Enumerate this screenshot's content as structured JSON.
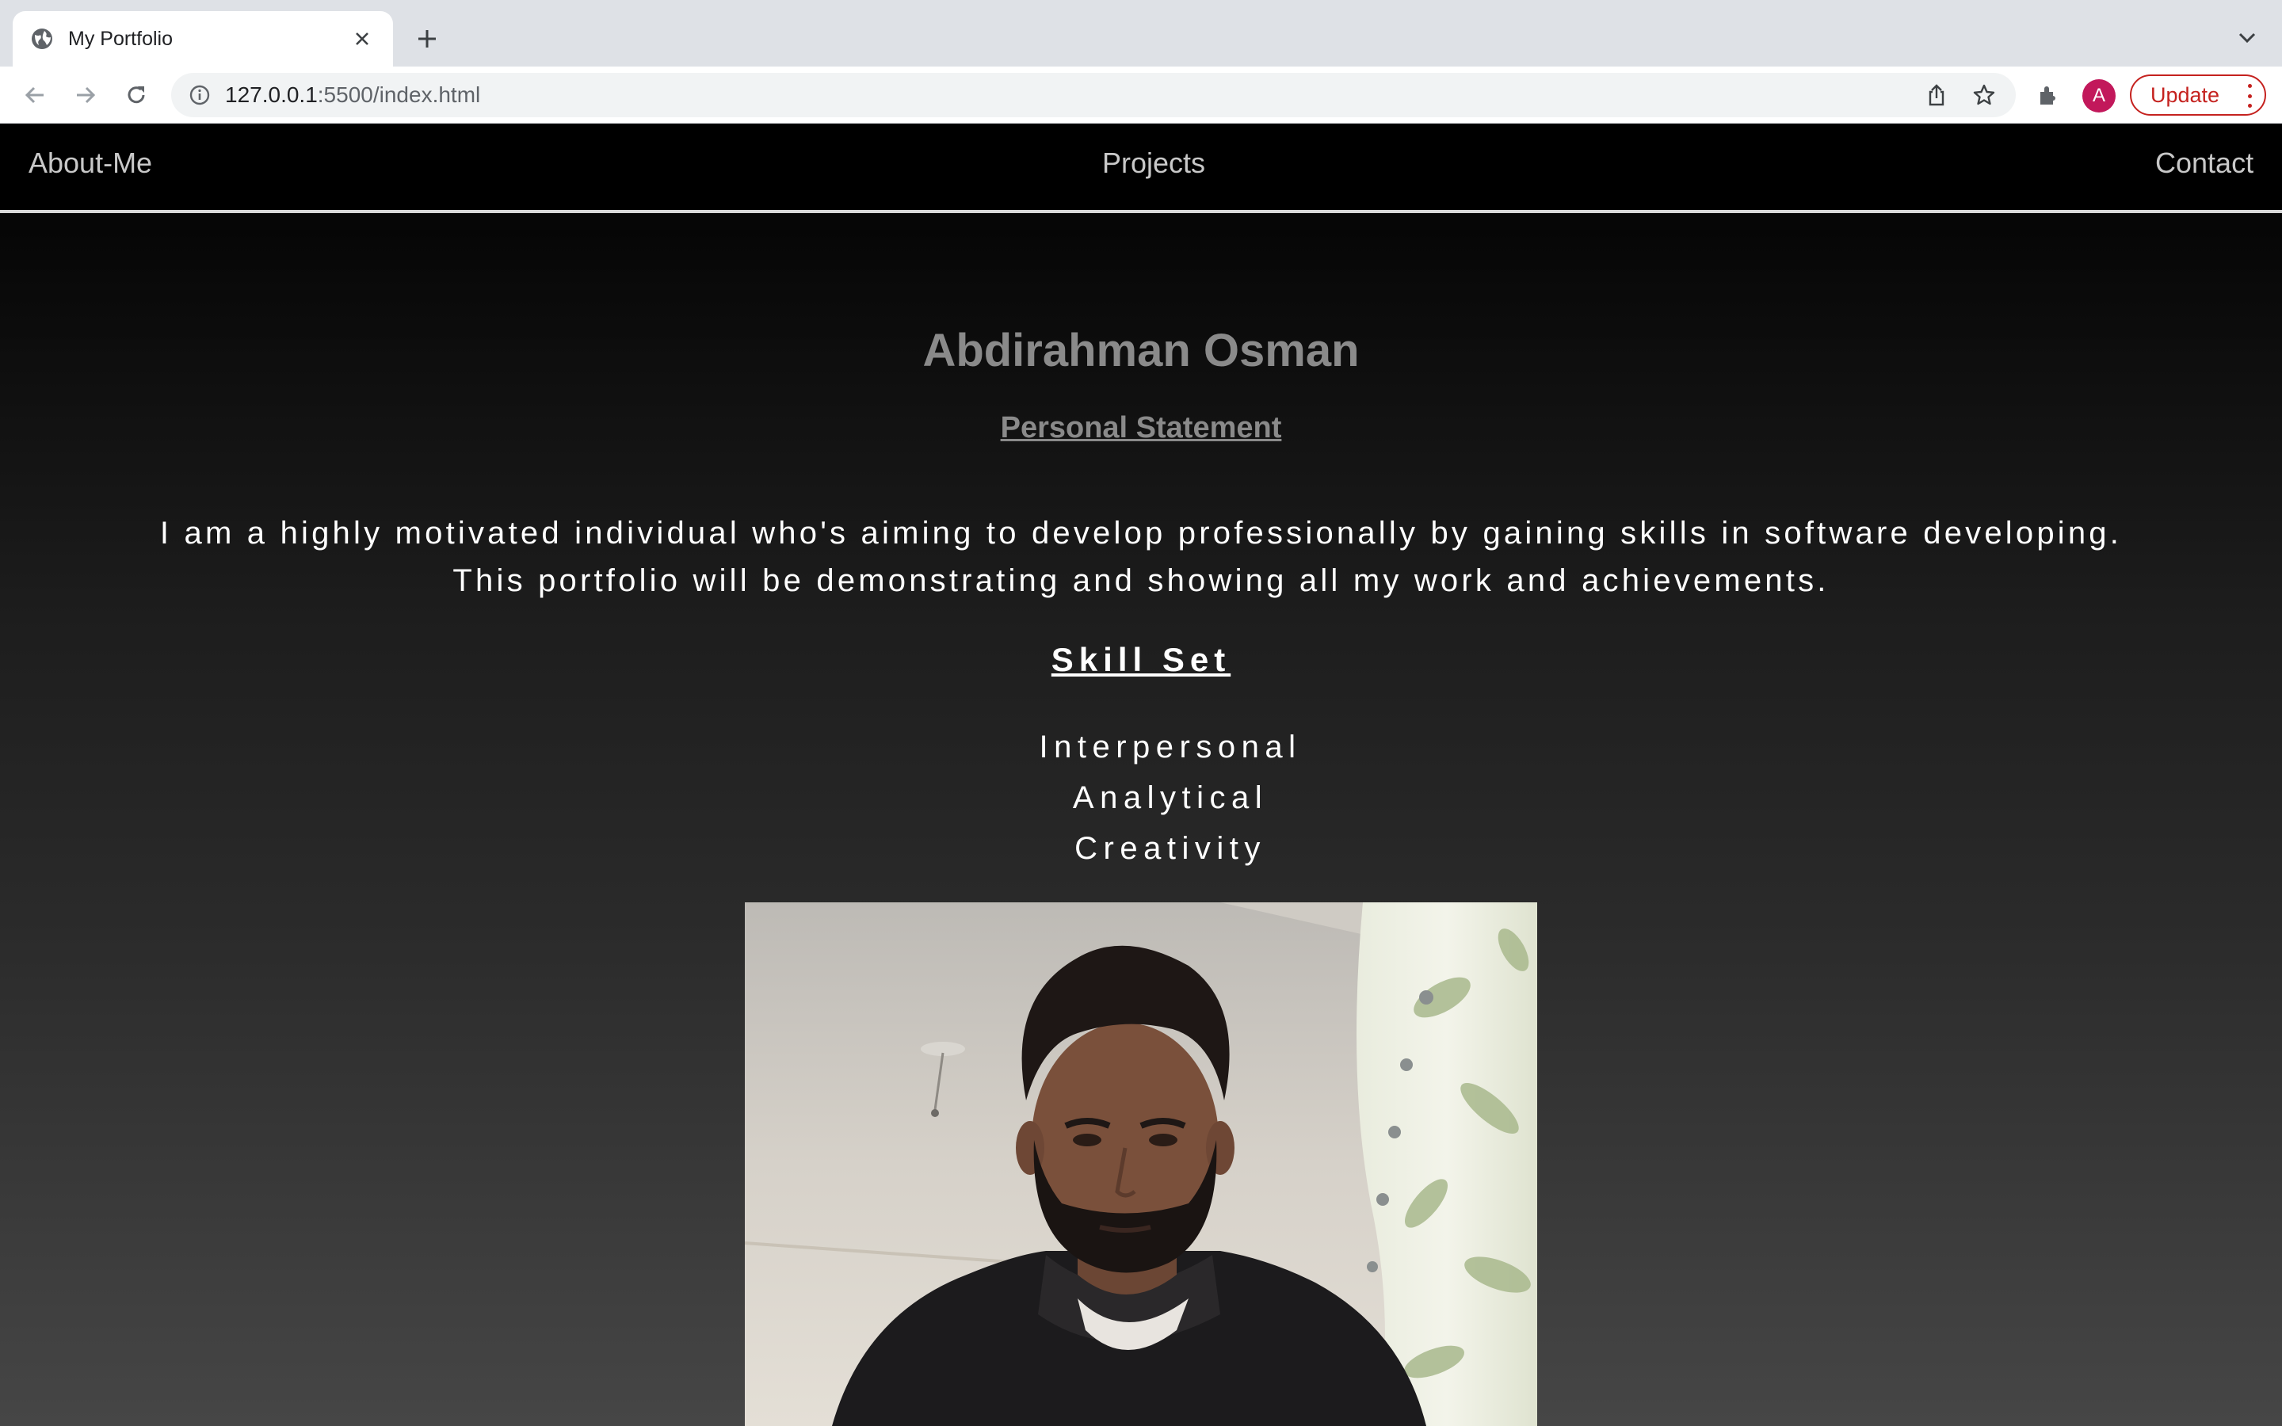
{
  "browser": {
    "tab_title": "My Portfolio",
    "url_host": "127.0.0.1",
    "url_rest": ":5500/index.html",
    "avatar_letter": "A",
    "update_label": "Update"
  },
  "nav": {
    "about": "About-Me",
    "projects": "Projects",
    "contact": "Contact"
  },
  "hero": {
    "name": "Abdirahman Osman",
    "subheading": "Personal Statement",
    "statement": "I am a highly motivated individual who's aiming to develop professionally by gaining skills in software developing. This portfolio will be demonstrating and showing all my work and achievements."
  },
  "skills": {
    "heading": "Skill Set",
    "items": [
      "Interpersonal",
      "Analytical",
      "Creativity"
    ]
  },
  "colors": {
    "accent_red": "#c5221f",
    "avatar": "#c2185b",
    "nav_bg": "#000000"
  }
}
